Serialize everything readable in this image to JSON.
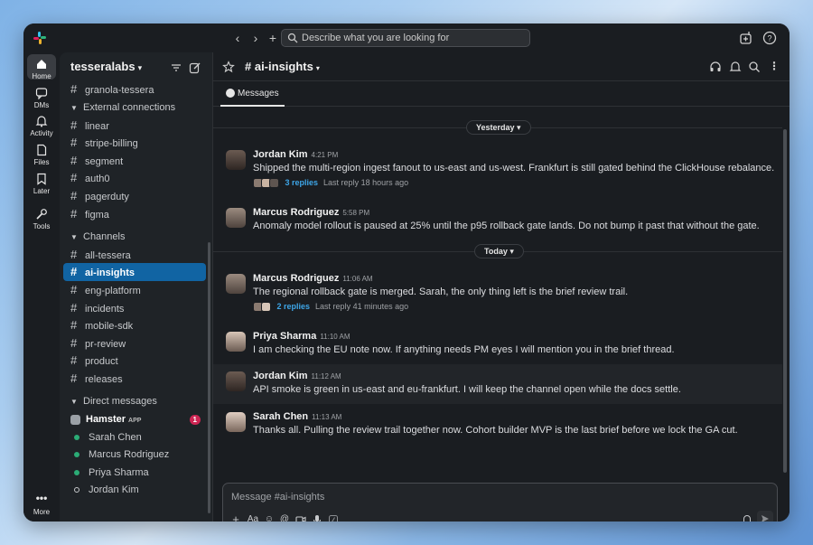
{
  "colors": {
    "accent": "#1164a3",
    "link": "#3ea6e8",
    "online": "#2bac76",
    "badge": "#cd2553"
  },
  "topbar": {
    "search_placeholder": "Describe what you are looking for",
    "icons": [
      "back-arrow-icon",
      "forward-arrow-icon",
      "plus-icon",
      "search-icon",
      "add-app-icon",
      "help-icon"
    ]
  },
  "rail": {
    "items": [
      {
        "label": "Home",
        "icon": "home-icon"
      },
      {
        "label": "DMs",
        "icon": "dms-icon"
      },
      {
        "label": "Activity",
        "icon": "bell-icon"
      },
      {
        "label": "Files",
        "icon": "file-icon"
      },
      {
        "label": "Later",
        "icon": "bookmark-icon"
      },
      {
        "label": "Tools",
        "icon": "wrench-icon"
      }
    ],
    "more_label": "More"
  },
  "sidebar": {
    "workspace": "tesseralabs",
    "top_channel": "granola-tessera",
    "external_section": "External connections",
    "external_channels": [
      "linear",
      "stripe-billing",
      "segment",
      "auth0",
      "pagerduty",
      "figma"
    ],
    "channels_section": "Channels",
    "channels": [
      "all-tessera",
      "ai-insights",
      "eng-platform",
      "incidents",
      "mobile-sdk",
      "pr-review",
      "product",
      "releases"
    ],
    "dm_section": "Direct messages",
    "hamster": {
      "name": "Hamster",
      "tag": "APP",
      "badge": "1"
    },
    "dms": [
      "Sarah Chen",
      "Marcus Rodriguez",
      "Priya Sharma",
      "Jordan Kim"
    ]
  },
  "channel": {
    "name": "ai-insights",
    "tab": "Messages"
  },
  "dates": {
    "yesterday": "Yesterday",
    "today": "Today"
  },
  "messages": [
    {
      "author": "Jordan Kim",
      "time": "4:21 PM",
      "text": "Shipped the multi-region ingest fanout to us-east and us-west. Frankfurt is still gated behind the ClickHouse rebalance.",
      "replies": "3 replies",
      "last": "Last reply 18 hours ago"
    },
    {
      "author": "Marcus Rodriguez",
      "time": "5:58 PM",
      "text": "Anomaly model rollout is paused at 25% until the p95 rollback gate lands. Do not bump it past that without the gate."
    },
    {
      "author": "Marcus Rodriguez",
      "time": "11:06 AM",
      "text": "The regional rollback gate is merged. Sarah, the only thing left is the brief review trail.",
      "replies": "2 replies",
      "last": "Last reply 41 minutes ago"
    },
    {
      "author": "Priya Sharma",
      "time": "11:10 AM",
      "text": "I am checking the EU note now. If anything needs PM eyes I will mention you in the brief thread."
    },
    {
      "author": "Jordan Kim",
      "time": "11:12 AM",
      "text": "API smoke is green in us-east and eu-frankfurt. I will keep the channel open while the docs settle."
    },
    {
      "author": "Sarah Chen",
      "time": "11:13 AM",
      "text": "Thanks all. Pulling the review trail together now. Cohort builder MVP is the last brief before we lock the GA cut."
    }
  ],
  "composer": {
    "placeholder": "Message #ai-insights"
  }
}
